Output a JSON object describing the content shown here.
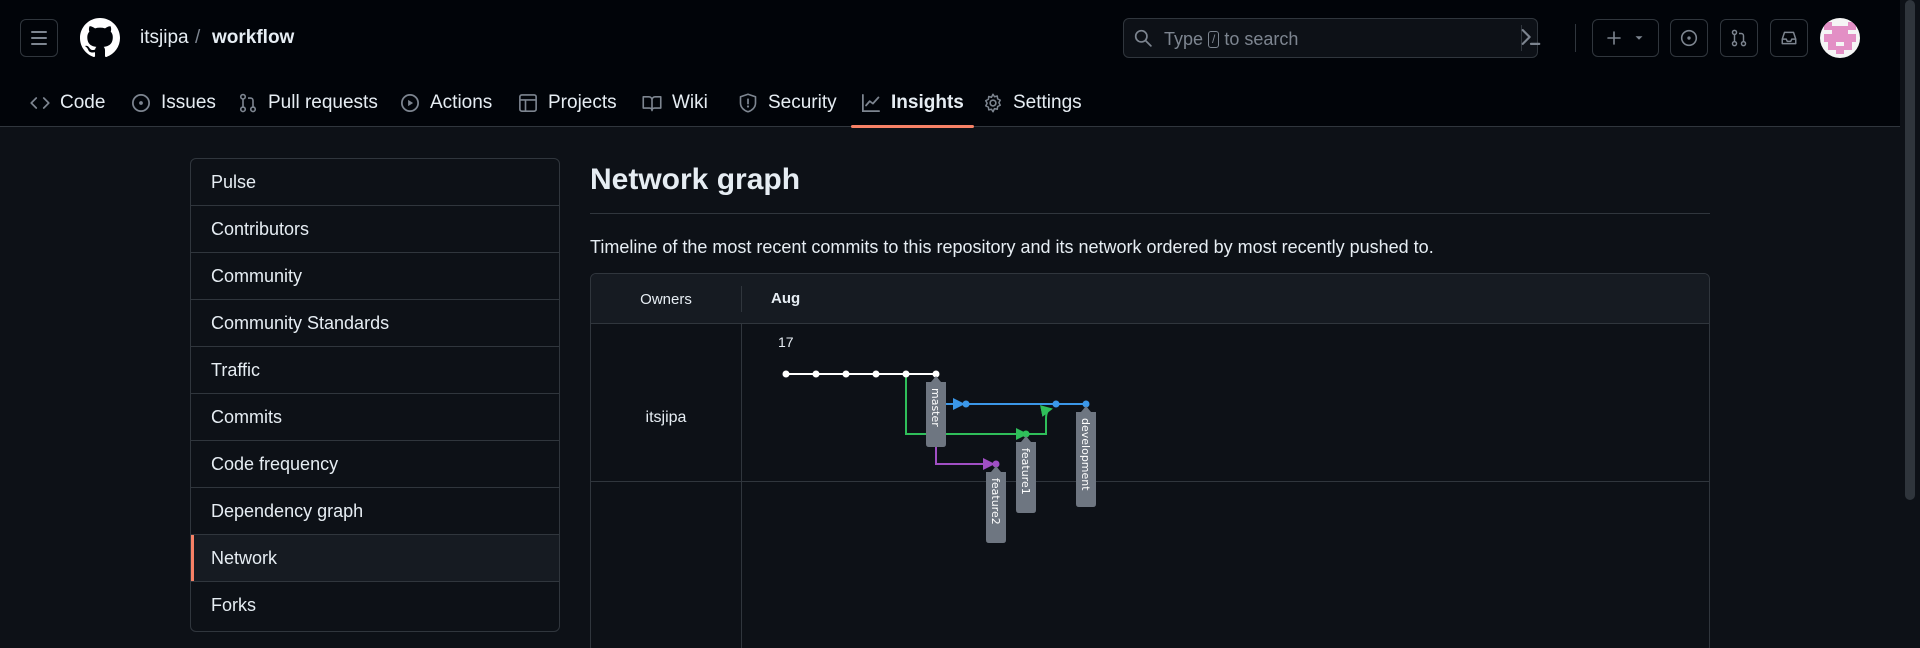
{
  "header": {
    "owner": "itsjipa",
    "separator": "/",
    "repo": "workflow",
    "search_prefix": "Type",
    "search_key": "/",
    "search_suffix": "to search"
  },
  "tabs": [
    {
      "label": "Code",
      "icon": "code-icon"
    },
    {
      "label": "Issues",
      "icon": "issue-opened-icon"
    },
    {
      "label": "Pull requests",
      "icon": "pull-request-icon"
    },
    {
      "label": "Actions",
      "icon": "play-icon"
    },
    {
      "label": "Projects",
      "icon": "table-icon"
    },
    {
      "label": "Wiki",
      "icon": "book-icon"
    },
    {
      "label": "Security",
      "icon": "shield-icon"
    },
    {
      "label": "Insights",
      "icon": "graph-icon",
      "active": true
    },
    {
      "label": "Settings",
      "icon": "gear-icon"
    }
  ],
  "sidebar": {
    "items": [
      {
        "label": "Pulse"
      },
      {
        "label": "Contributors"
      },
      {
        "label": "Community"
      },
      {
        "label": "Community Standards"
      },
      {
        "label": "Traffic"
      },
      {
        "label": "Commits"
      },
      {
        "label": "Code frequency"
      },
      {
        "label": "Dependency graph"
      },
      {
        "label": "Network",
        "selected": true
      },
      {
        "label": "Forks"
      }
    ]
  },
  "main": {
    "title": "Network graph",
    "description": "Timeline of the most recent commits to this repository and its network ordered by most recently pushed to.",
    "graph": {
      "owners_header": "Owners",
      "month": "Aug",
      "day": "17",
      "owner": "itsjipa",
      "branches": [
        {
          "name": "master",
          "color": "#ffffff"
        },
        {
          "name": "development",
          "color": "#3b97e8"
        },
        {
          "name": "feature1",
          "color": "#2fbf5a"
        },
        {
          "name": "feature2",
          "color": "#a04fc4"
        }
      ]
    }
  },
  "colors": {
    "accent": "#f78166",
    "background": "#0d1117",
    "header_bg": "#010409",
    "border": "#30363d"
  }
}
